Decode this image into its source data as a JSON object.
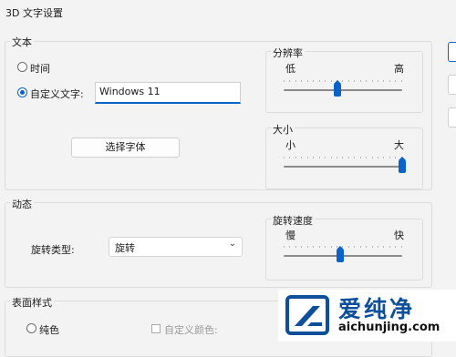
{
  "window": {
    "title": "3D 文字设置"
  },
  "text_group": {
    "label": "文本",
    "radio_time": "时间",
    "radio_custom": "自定义文字:",
    "custom_value": "Windows 11",
    "font_button": "选择字体"
  },
  "resolution": {
    "label": "分辨率",
    "low": "低",
    "high": "高",
    "value_fraction": 0.45
  },
  "size": {
    "label": "大小",
    "small": "小",
    "large": "大",
    "value_fraction": 1.0
  },
  "motion_group": {
    "label": "动态",
    "rotation_type_label": "旋转类型:",
    "rotation_type_value": "旋转"
  },
  "rotation_speed": {
    "label": "旋转速度",
    "slow": "慢",
    "fast": "快",
    "value_fraction": 0.48
  },
  "surface_group": {
    "label": "表面样式",
    "radio_solid": "纯色",
    "checkbox_custom_color": "自定义颜色:"
  },
  "watermark": {
    "brand": "爱纯净",
    "url": "aichunjing.com"
  },
  "colors": {
    "accent": "#0b63c9",
    "watermark_blue": "#0e4f9b"
  }
}
